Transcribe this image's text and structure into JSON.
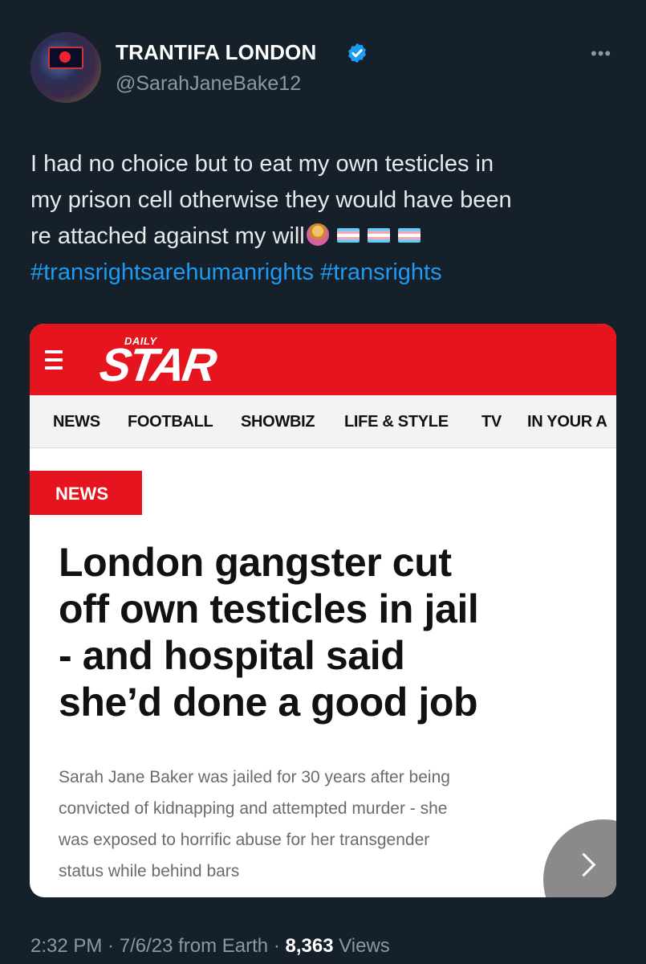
{
  "author": {
    "display_name": "TRANTIFA LONDON",
    "handle": "@SarahJaneBake12",
    "verified_color": "#1d9bf0"
  },
  "more_icon": "more-horizontal-icon",
  "tweet": {
    "lines": [
      "I had no choice but to eat my own testicles in",
      "my prison cell otherwise they would have been",
      "re attached against my will"
    ],
    "emojis": [
      "person-shrugging-emoji",
      "transgender-flag-emoji",
      "transgender-flag-emoji",
      "transgender-flag-emoji"
    ],
    "hashtags": [
      "#transrightsarehumanrights",
      "#transrights"
    ]
  },
  "card": {
    "logo_small": "DAILY",
    "logo_big": "STAR",
    "nav": [
      "NEWS",
      "FOOTBALL",
      "SHOWBIZ",
      "LIFE & STYLE",
      "TV",
      "IN YOUR A"
    ],
    "section": "NEWS",
    "headline_lines": [
      "London gangster cut",
      "off own testicles in jail",
      "- and hospital said",
      "she’d done a good job"
    ],
    "standfirst_lines": [
      "Sarah Jane Baker was jailed for 30 years after being",
      "convicted of kidnapping and attempted murder - she",
      "was exposed to horrific abuse for her transgender",
      "status while behind bars"
    ],
    "brand_color": "#e6141e"
  },
  "footer": {
    "time": "2:32 PM",
    "date": "7/6/23",
    "source": "from Earth",
    "views_count": "8,363",
    "views_label": "Views"
  }
}
